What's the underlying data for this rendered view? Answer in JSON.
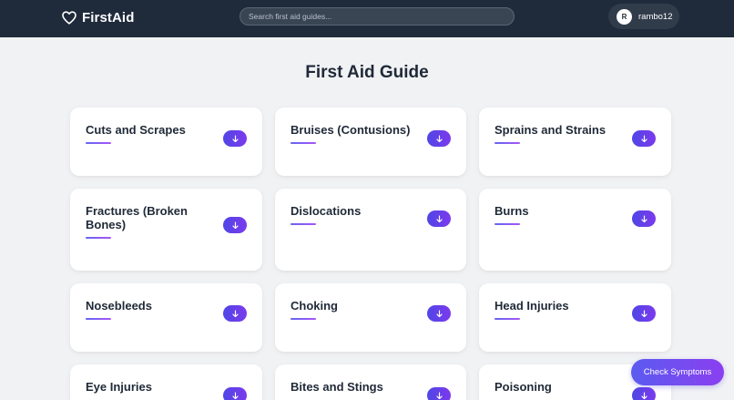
{
  "header": {
    "brand": "FirstAid",
    "brand_icon": "heart-outline-icon",
    "search_placeholder": "Search first aid guides...",
    "search_value": "",
    "user": {
      "initial": "R",
      "name": "rambo12"
    }
  },
  "main": {
    "title": "First Aid Guide",
    "expand_icon": "arrow-down-icon",
    "guides": [
      {
        "title": "Cuts and Scrapes"
      },
      {
        "title": "Bruises (Contusions)"
      },
      {
        "title": "Sprains and Strains"
      },
      {
        "title": "Fractures (Broken Bones)"
      },
      {
        "title": "Dislocations"
      },
      {
        "title": "Burns"
      },
      {
        "title": "Nosebleeds"
      },
      {
        "title": "Choking"
      },
      {
        "title": "Head Injuries"
      },
      {
        "title": "Eye Injuries"
      },
      {
        "title": "Bites and Stings"
      },
      {
        "title": "Poisoning"
      }
    ]
  },
  "floating_action": {
    "label": "Check Symptoms"
  },
  "colors": {
    "navbar": "#1f2a3a",
    "background": "#f1f2f4",
    "accent_start": "#4f46e5",
    "accent_end": "#7c3aed"
  }
}
